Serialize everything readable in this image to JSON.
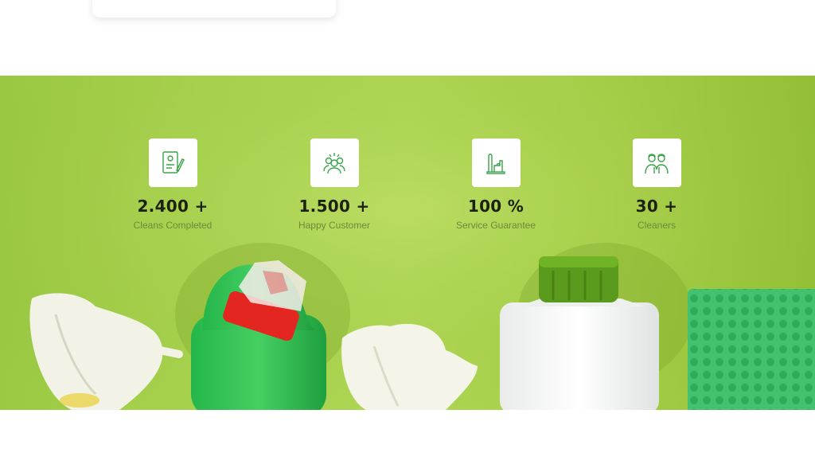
{
  "stats": [
    {
      "value": "2.400 +",
      "label": "Cleans Completed",
      "icon": "document-check-icon"
    },
    {
      "value": "1.500 +",
      "label": "Happy Customer",
      "icon": "happy-customers-icon"
    },
    {
      "value": "100 %",
      "label": "Service Guarantee",
      "icon": "cleaning-tools-icon"
    },
    {
      "value": "30 +",
      "label": "Cleaners",
      "icon": "cleaners-team-icon"
    }
  ],
  "colors": {
    "band_green": "#a8d350",
    "icon_green": "#3aa34a",
    "value_text": "#1d2210",
    "label_text": "#6d8a3a"
  }
}
